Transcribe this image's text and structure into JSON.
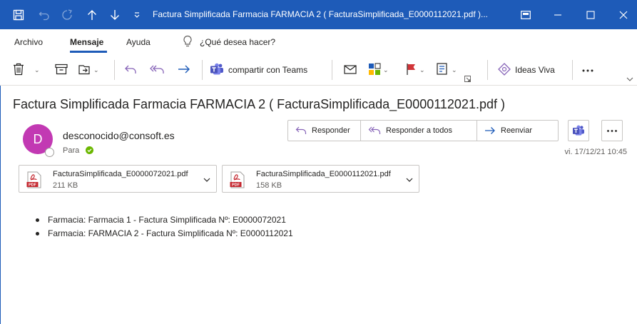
{
  "window": {
    "title": "Factura Simplificada Farmacia FARMACIA 2 ( FacturaSimplificada_E0000112021.pdf )...",
    "accent": "#1e5bb8"
  },
  "menu": {
    "tabs": [
      "Archivo",
      "Mensaje",
      "Ayuda"
    ],
    "active": "Mensaje",
    "search_placeholder": "¿Qué desea hacer?"
  },
  "ribbon": {
    "teams_label": "compartir con Teams",
    "ideas_label": "Ideas Viva",
    "icons": [
      "delete-icon",
      "archive-icon",
      "move-icon",
      "undo-icon",
      "reply-all-icon",
      "forward-icon",
      "teams-icon",
      "mark-unread-icon",
      "categorize-icon",
      "flag-icon",
      "print-icon",
      "ideas-icon",
      "more-icon"
    ]
  },
  "message": {
    "subject": "Factura Simplificada Farmacia FARMACIA 2 ( FacturaSimplificada_E0000112021.pdf )",
    "sender": "desconocido@consoft.es",
    "avatar_initial": "D",
    "avatar_color": "#c239b3",
    "to_label": "Para",
    "date": "vi. 17/12/21 10:45",
    "actions": {
      "reply": "Responder",
      "reply_all": "Responder a todos",
      "forward": "Reenviar"
    },
    "attachments": [
      {
        "name": "FacturaSimplificada_E0000072021.pdf",
        "size": "211 KB"
      },
      {
        "name": "FacturaSimplificada_E0000112021.pdf",
        "size": "158 KB"
      }
    ],
    "body_items": [
      "Farmacia: Farmacia 1 - Factura Simplificada Nº: E0000072021",
      "Farmacia: FARMACIA 2 - Factura Simplificada Nº: E0000112021"
    ]
  }
}
